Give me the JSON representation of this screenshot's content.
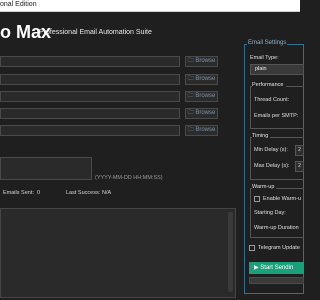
{
  "window": {
    "title": "onal Edition"
  },
  "header": {
    "title": "o Max",
    "subtitle": "Professional Email Automation Suite"
  },
  "files": {
    "browse_label": "🗀 Browse",
    "rows": [
      {
        "value": ""
      },
      {
        "value": ""
      },
      {
        "value": ""
      },
      {
        "value": ""
      },
      {
        "value": ""
      }
    ]
  },
  "schedule": {
    "hint": "(YYYY-MM-DD HH:MM:SS)"
  },
  "stats": {
    "emails_sent_label": "Emails Sent:",
    "emails_sent_value": "0",
    "last_success_label": "Last Success:",
    "last_success_value": "N/A"
  },
  "settings": {
    "title": "Email Settings",
    "email_type_label": "Email Type:",
    "email_type_value": "plain",
    "performance": {
      "title": "Performance",
      "thread_count_label": "Thread Count:",
      "emails_per_smtp_label": "Emails per SMTP:"
    },
    "timing": {
      "title": "Timing",
      "min_delay_label": "Min Delay (s):",
      "max_delay_label": "Max Delay (s):",
      "min_delay_value": "2",
      "max_delay_value": "2"
    },
    "warmup": {
      "title": "Warm-up",
      "enable_label": "Enable Warm-u",
      "starting_day_label": "Starting Day:",
      "duration_label": "Warm-up Duration"
    },
    "telegram_label": "Telegram Update",
    "start_button": "▶ Start Sendin"
  }
}
